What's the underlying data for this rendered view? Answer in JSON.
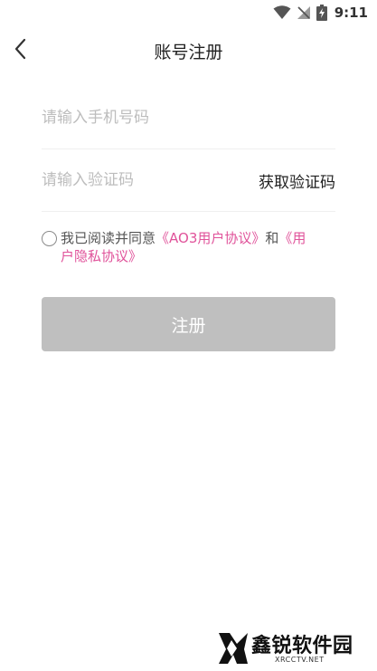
{
  "status_bar": {
    "time": "9:11"
  },
  "header": {
    "title": "账号注册"
  },
  "form": {
    "phone_placeholder": "请输入手机号码",
    "code_placeholder": "请输入验证码",
    "get_code_label": "获取验证码"
  },
  "agreement": {
    "prefix": "我已阅读并同意",
    "user_agreement_line1": "《AO3用户协议》",
    "conjunction": "和",
    "privacy_part1": "《用",
    "privacy_part2": "户隐私协议》"
  },
  "register_button": {
    "label": "注册"
  },
  "watermark": {
    "text": "鑫锐软件园",
    "sub": "XRCCTV.NET"
  },
  "colors": {
    "link": "#e0529a",
    "button_disabled": "#bfbfbf",
    "divider": "#efefef"
  }
}
